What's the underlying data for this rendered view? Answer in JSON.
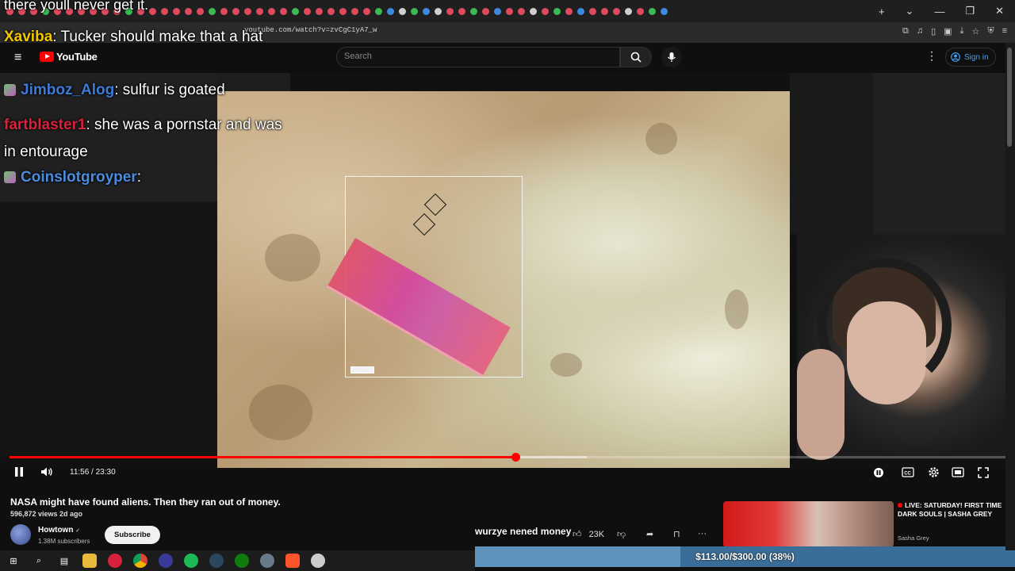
{
  "browser": {
    "url": "youtube.com/watch?v=zvCgC1yA7_w",
    "window_controls": [
      "⌄",
      "—",
      "❐",
      "✕"
    ],
    "new_tab_label": "+"
  },
  "header": {
    "logo_text": "YouTube",
    "search_placeholder": "Search",
    "signin_label": "Sign in",
    "menu_icon": "≡",
    "more_icon": "⋮"
  },
  "chat": {
    "top_partial": "there youll never get it.",
    "messages": [
      {
        "user": "Xaviba",
        "text": ": Tucker should make that a hat",
        "color": "#f2c800"
      },
      {
        "user": "Jimboz_Alog",
        "text": ": sulfur is goated",
        "color": "#3d7bd9"
      },
      {
        "user": "fartblaster1",
        "text": ": she was a pornstar and was in entourage",
        "color": "#d8213c"
      },
      {
        "user": "Coinslotgroyper",
        "text": ":",
        "color": "#4a8ce0"
      }
    ]
  },
  "player": {
    "timecode": "11:56 / 23:30",
    "progress_fraction": 0.508,
    "buffer_fraction": 0.58,
    "scale_label": "1mm"
  },
  "video_info": {
    "title": "NASA might have found aliens. Then they ran out of money.",
    "views": "596,872 views  2d ago",
    "channel": "Howtown",
    "verified": "✓",
    "subscribers": "1.38M subscribers",
    "subscribe_label": "Subscribe",
    "like_count": "23K"
  },
  "overlay": {
    "message": "wurzye nened money"
  },
  "recommendation": {
    "title": "LIVE: SATURDAY! FIRST TIME DARK SOULS | SASHA GREY",
    "channel": "Sasha Grey"
  },
  "donation": {
    "text": "$113.00/$300.00 (38%)",
    "fraction": 0.38
  },
  "colors": {
    "accent_red": "#ff0000",
    "link_blue": "#3ea6ff"
  }
}
